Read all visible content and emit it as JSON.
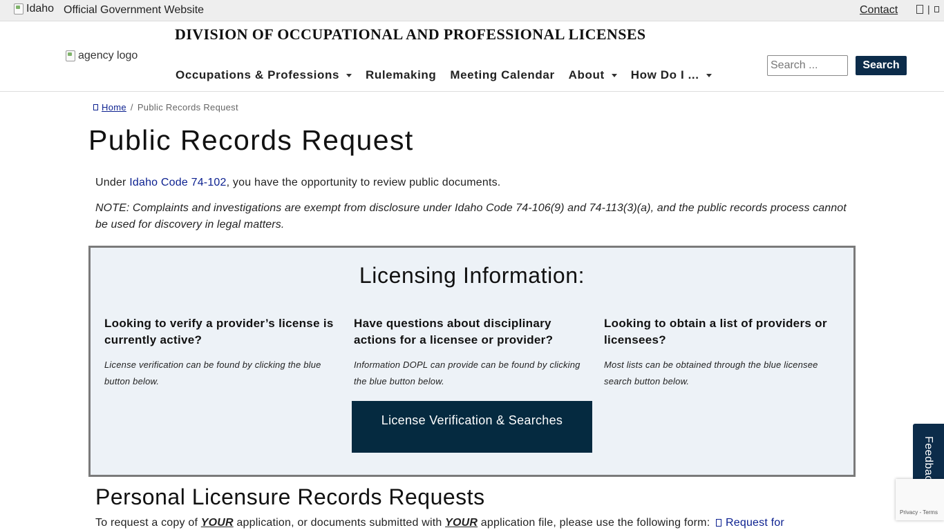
{
  "govbar": {
    "logo_alt": "Idaho",
    "text": "Official Government Website",
    "contact": "Contact",
    "separator": "|"
  },
  "header": {
    "logo_alt": "agency logo",
    "site_title": "DIVISION OF OCCUPATIONAL AND PROFESSIONAL LICENSES",
    "nav": [
      {
        "label": "Occupations & Professions",
        "dropdown": true
      },
      {
        "label": "Rulemaking",
        "dropdown": false
      },
      {
        "label": "Meeting Calendar",
        "dropdown": false
      },
      {
        "label": "About",
        "dropdown": true
      },
      {
        "label": "How Do I ...",
        "dropdown": true
      }
    ],
    "search_placeholder": "Search ...",
    "search_button": "Search"
  },
  "breadcrumb": {
    "home": "Home",
    "separator": "/",
    "current": "Public Records Request"
  },
  "page_title": "Public Records Request",
  "intro": {
    "prefix": "Under ",
    "link": "Idaho Code 74-102",
    "suffix": ", you have the opportunity to review public documents."
  },
  "note": "NOTE: Complaints and investigations are exempt from disclosure under Idaho Code 74-106(9) and 74-113(3)(a), and the public records process cannot be used for discovery in legal matters.",
  "licensing": {
    "title": "Licensing Information:",
    "columns": [
      {
        "question": "Looking to verify a provider’s license is currently active?",
        "answer": "License verification can be found by clicking the blue button below."
      },
      {
        "question": "Have questions about disciplinary actions for a licensee or provider?",
        "answer": "Information DOPL can provide can be found by clicking the blue button below."
      },
      {
        "question": "Looking to obtain a list of providers or licensees?",
        "answer": "Most lists can be obtained through the blue licensee search button below."
      }
    ],
    "button": "License Verification & Searches"
  },
  "personal": {
    "title": "Personal Licensure Records Requests",
    "p1": "To request a copy of ",
    "em1": "YOUR",
    "p2": " application, or documents submitted with ",
    "em2": "YOUR",
    "p3": " application file, please use the following form: ",
    "link": "Request for"
  },
  "feedback": "Feedback",
  "recaptcha": "Privacy - Terms",
  "colors": {
    "navy": "#0c2c4a",
    "button_dark": "#052a40",
    "box_bg": "#edf2f7",
    "link": "#0a1f8f"
  }
}
